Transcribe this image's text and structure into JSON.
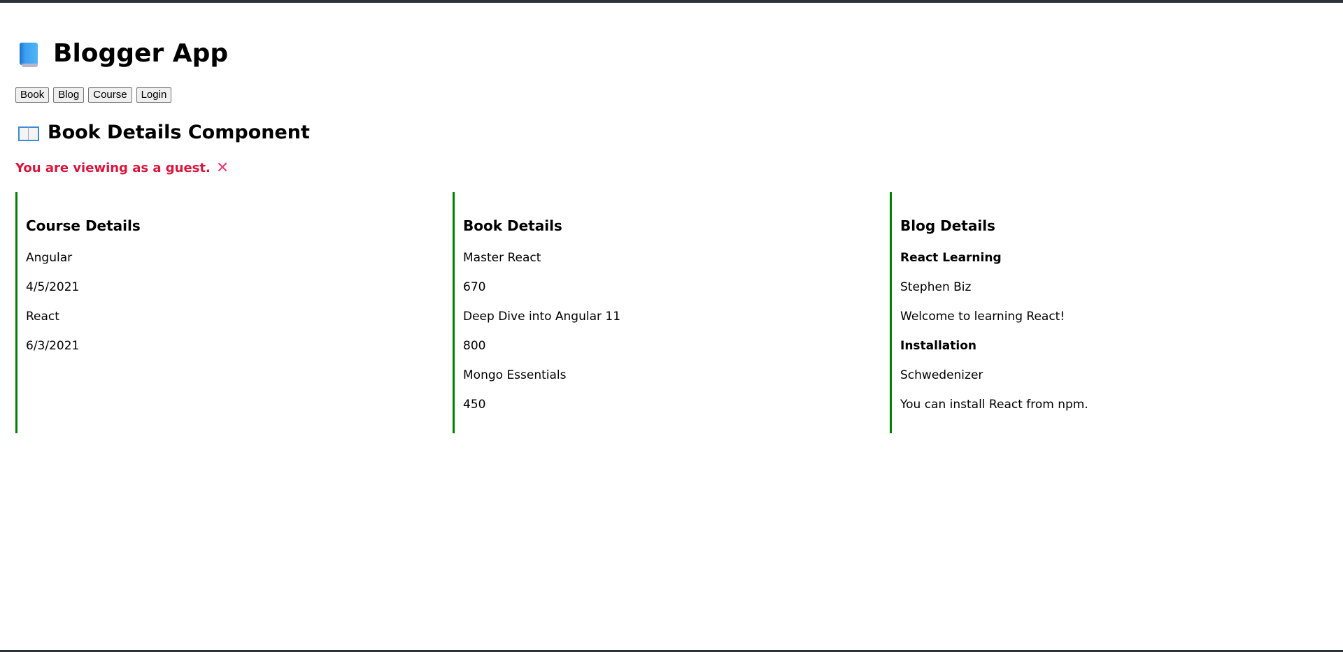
{
  "app": {
    "title": "Blogger App",
    "title_icon": "blue-book-icon"
  },
  "nav": {
    "buttons": [
      "Book",
      "Blog",
      "Course",
      "Login"
    ]
  },
  "component": {
    "title": "Book Details Component",
    "title_icon": "open-book-icon"
  },
  "guest_message": {
    "text": "You are viewing as a guest.",
    "icon": "cross-mark-icon",
    "color": "#dc143c"
  },
  "accent_color": "#008000",
  "course_details": {
    "heading": "Course Details",
    "items": [
      {
        "name": "Angular",
        "date": "4/5/2021"
      },
      {
        "name": "React",
        "date": "6/3/2021"
      }
    ]
  },
  "book_details": {
    "heading": "Book Details",
    "items": [
      {
        "name": "Master React",
        "price": "670"
      },
      {
        "name": "Deep Dive into Angular 11",
        "price": "800"
      },
      {
        "name": "Mongo Essentials",
        "price": "450"
      }
    ]
  },
  "blog_details": {
    "heading": "Blog Details",
    "items": [
      {
        "title": "React Learning",
        "author": "Stephen Biz",
        "content": "Welcome to learning React!"
      },
      {
        "title": "Installation",
        "author": "Schwedenizer",
        "content": "You can install React from npm."
      }
    ]
  }
}
